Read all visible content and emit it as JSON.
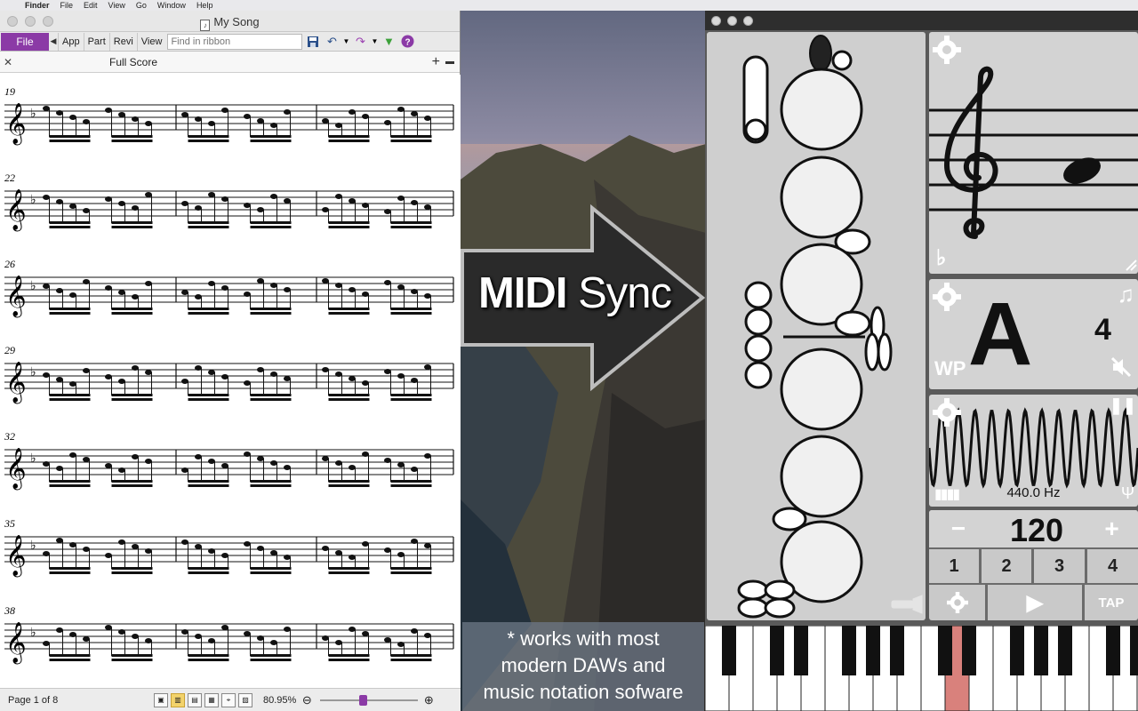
{
  "menubar": {
    "items": [
      "Finder",
      "File",
      "Edit",
      "View",
      "Go",
      "Window",
      "Help"
    ]
  },
  "score_window": {
    "title": "My Song",
    "ribbon": {
      "file_label": "File",
      "tabs": [
        "App",
        "Part",
        "Revi",
        "View"
      ],
      "search_placeholder": "Find in ribbon"
    },
    "tab_label": "Full Score",
    "bar_numbers": [
      "19",
      "22",
      "26",
      "29",
      "32",
      "35",
      "38"
    ],
    "status": {
      "page_info": "Page 1 of 8",
      "zoom": "80.95%"
    }
  },
  "overlay": {
    "midi_sync_bold": "MIDI",
    "midi_sync_light": "Sync",
    "note_line1": "* works with most",
    "note_line2": "modern DAWs and",
    "note_line3": "music notation sofware"
  },
  "tuner_app": {
    "note_name": "A",
    "octave": "4",
    "wp_label": "WP",
    "frequency": "440.0 Hz",
    "metronome": {
      "minus": "−",
      "tempo": "120",
      "plus": "+",
      "beats": [
        "1",
        "2",
        "3",
        "4"
      ],
      "tap": "TAP"
    }
  },
  "colors": {
    "file_button": "#8b3aa6",
    "highlighted_key": "#d9817c"
  }
}
